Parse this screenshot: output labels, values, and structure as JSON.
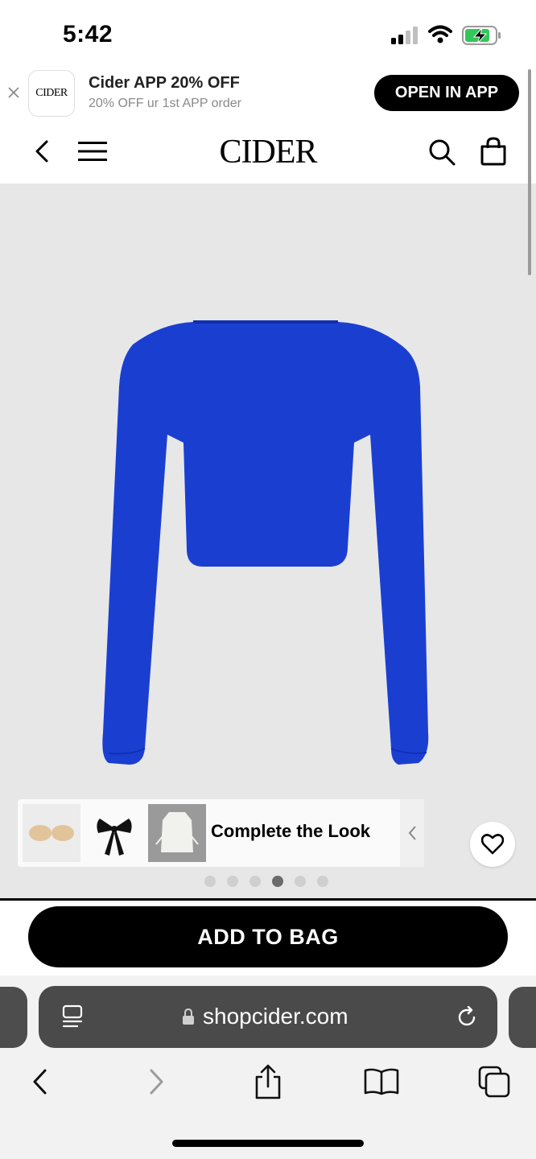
{
  "status_bar": {
    "time": "5:42"
  },
  "app_banner": {
    "logo_text": "CIDER",
    "title": "Cider APP 20% OFF",
    "subtitle": "20% OFF ur 1st APP order",
    "open_button": "OPEN IN APP"
  },
  "header": {
    "brand": "CIDER"
  },
  "product": {
    "color_hex": "#1a3fd0",
    "complete_the_look_label": "Complete the Look",
    "image_pager": {
      "total": 6,
      "active": 4
    }
  },
  "actions": {
    "add_to_bag": "ADD TO BAG"
  },
  "browser": {
    "url": "shopcider.com"
  }
}
